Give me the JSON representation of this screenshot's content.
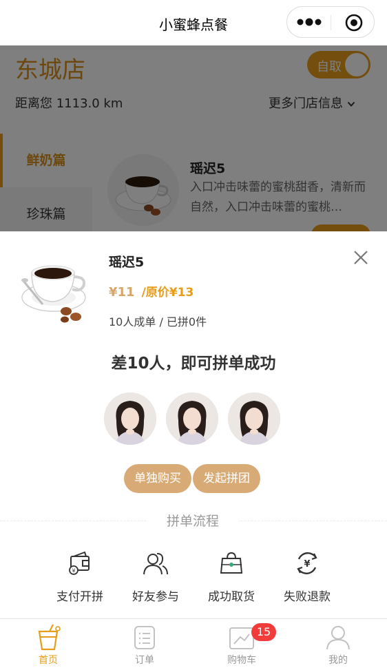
{
  "nav": {
    "title": "小蜜蜂点餐"
  },
  "store": {
    "name": "东城店",
    "pickup_label": "自取",
    "distance": "距离您 1113.0 km",
    "more_info": "更多门店信息"
  },
  "categories": [
    {
      "label": "鲜奶篇",
      "active": true
    },
    {
      "label": "珍珠篇",
      "active": false
    }
  ],
  "product_card": {
    "name": "瑶迟5",
    "description": "入口冲击味蕾的蜜桃甜香，清新而自然，入口冲击味蕾的蜜桃…"
  },
  "popup": {
    "product_name": "瑶迟5",
    "price": "¥11",
    "original_price": "/原价¥13",
    "group_stats": "10人成单 / 已拼0件",
    "need_message": "差10人，即可拼单成功",
    "avatar_count": 3,
    "buy_alone_label": "单独购买",
    "start_group_label": "发起拼团",
    "flow_title": "拼单流程",
    "flow_steps": [
      {
        "label": "支付开拼",
        "icon": "wallet-icon"
      },
      {
        "label": "好友参与",
        "icon": "friends-icon"
      },
      {
        "label": "成功取货",
        "icon": "bag-icon"
      },
      {
        "label": "失败退款",
        "icon": "refund-icon"
      }
    ]
  },
  "tabbar": {
    "tabs": [
      {
        "label": "首页",
        "icon": "home-cup-icon",
        "active": true
      },
      {
        "label": "订单",
        "icon": "order-list-icon",
        "active": false
      },
      {
        "label": "购物车",
        "icon": "cart-icon",
        "active": false,
        "badge": "15"
      },
      {
        "label": "我的",
        "icon": "profile-icon",
        "active": false
      }
    ]
  },
  "colors": {
    "accent": "#e79d1a",
    "price": "#d8a56a",
    "button": "#d8ab76",
    "badge": "#f23b3b"
  }
}
